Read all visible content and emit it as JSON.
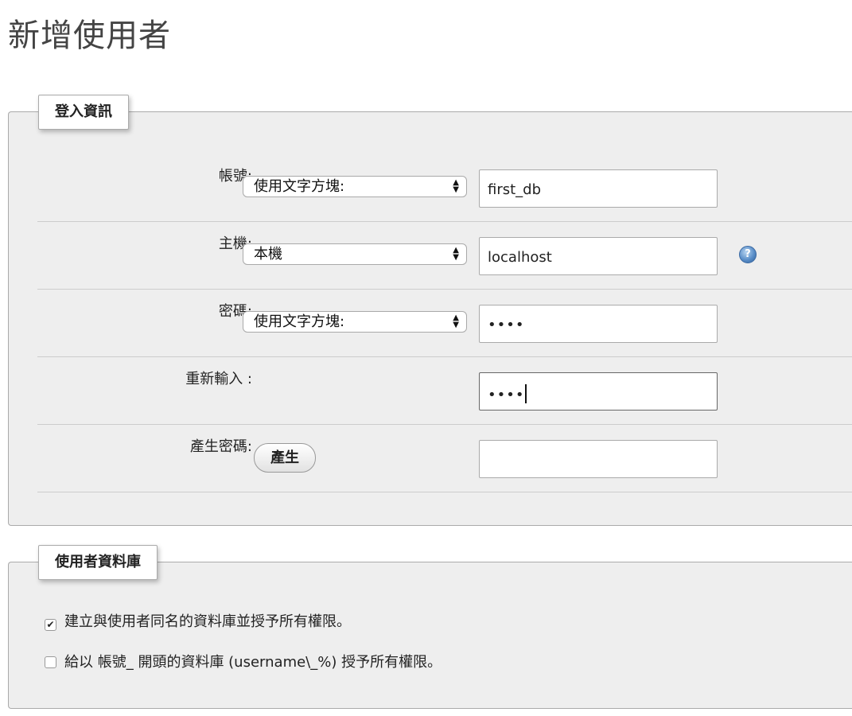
{
  "page_title": "新增使用者",
  "login_section": {
    "legend": "登入資訊",
    "username": {
      "label": "帳號:",
      "select_value": "使用文字方塊:",
      "input_value": "first_db"
    },
    "host": {
      "label": "主機:",
      "select_value": "本機",
      "input_value": "localhost",
      "help_icon": "help-icon"
    },
    "password": {
      "label": "密碼:",
      "select_value": "使用文字方塊:",
      "input_value": "••••"
    },
    "retype": {
      "label": "重新輸入 :",
      "input_value": "••••"
    },
    "generate": {
      "label": "產生密碼:",
      "button_label": "產生",
      "input_value": ""
    }
  },
  "db_section": {
    "legend": "使用者資料庫",
    "options": [
      {
        "label": "建立與使用者同名的資料庫並授予所有權限。",
        "checked": true
      },
      {
        "label": "給以 帳號_ 開頭的資料庫 (username\\_%) 授予所有權限。",
        "checked": false
      }
    ]
  }
}
